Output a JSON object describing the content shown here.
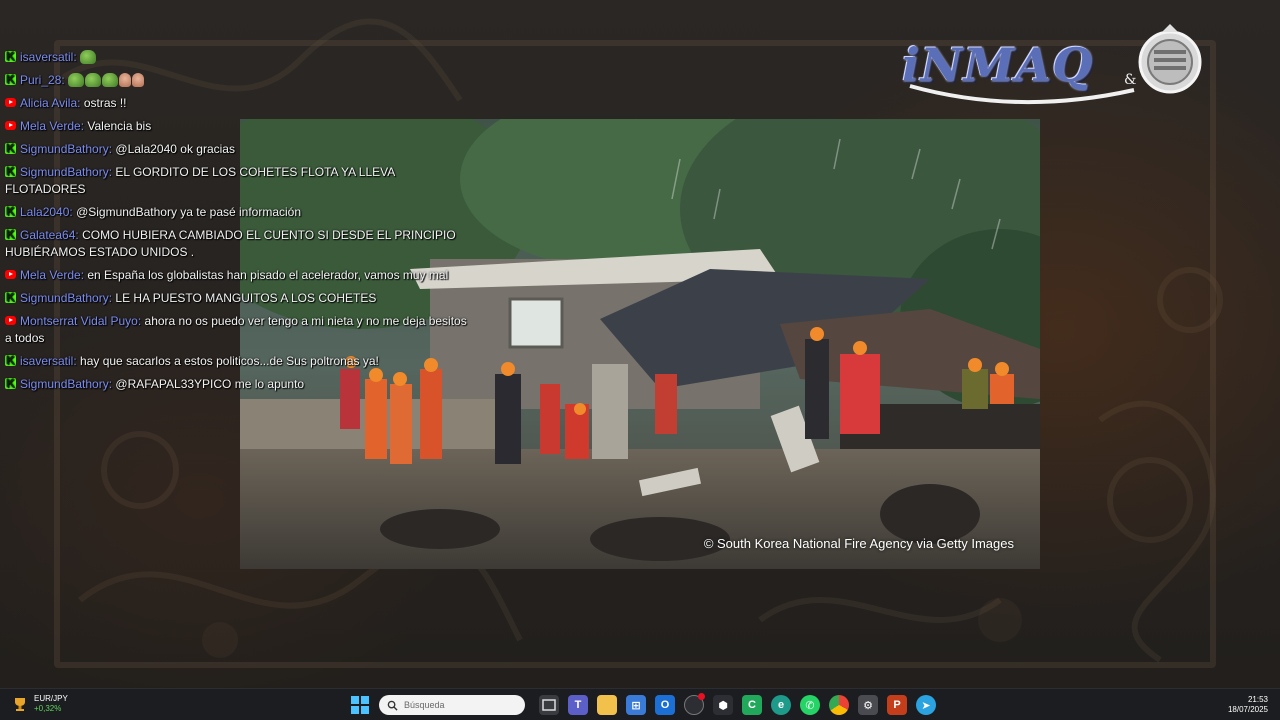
{
  "chat": {
    "messages": [
      {
        "platform": "kick",
        "user": "isaversatil",
        "text": "",
        "emotes": [
          "frog"
        ]
      },
      {
        "platform": "kick",
        "user": "Puri_28",
        "text": "",
        "emotes": [
          "frog",
          "frog",
          "frog",
          "hand",
          "hand"
        ]
      },
      {
        "platform": "youtube",
        "user": "Alicia Avila",
        "text": "ostras !!",
        "emotes": []
      },
      {
        "platform": "youtube",
        "user": "Mela Verde",
        "text": "Valencia bis",
        "emotes": []
      },
      {
        "platform": "kick",
        "user": "SigmundBathory",
        "text": "@Lala2040 ok gracias",
        "emotes": []
      },
      {
        "platform": "kick",
        "user": "SigmundBathory",
        "text": "EL GORDITO DE LOS COHETES FLOTA YA LLEVA FLOTADORES",
        "emotes": []
      },
      {
        "platform": "kick",
        "user": "Lala2040",
        "text": "@SigmundBathory ya te pasé información",
        "emotes": []
      },
      {
        "platform": "kick",
        "user": "Galatea64",
        "text": "COMO HUBIERA CAMBIADO EL CUENTO SI DESDE EL PRINCIPIO HUBIÉRAMOS ESTADO UNIDOS .",
        "emotes": []
      },
      {
        "platform": "youtube",
        "user": "Mela Verde",
        "text": "en España los globalistas han pisado el acelerador, vamos muy mal",
        "emotes": []
      },
      {
        "platform": "kick",
        "user": "SigmundBathory",
        "text": "LE HA PUESTO MANGUITOS A LOS COHETES",
        "emotes": []
      },
      {
        "platform": "youtube",
        "user": "Montserrat Vidal Puyo",
        "text": "ahora no os puedo ver tengo a mi nieta y no me deja besitos a todos",
        "emotes": []
      },
      {
        "platform": "kick",
        "user": "isaversatil",
        "text": "hay que sacarlos a estos politicos...de Sus poltronas ya!",
        "emotes": []
      },
      {
        "platform": "kick",
        "user": "SigmundBathory",
        "text": "@RAFAPAL33YPICO me lo apunto",
        "emotes": []
      }
    ]
  },
  "logo": {
    "text": "iNMAQ",
    "amp": "&"
  },
  "photo": {
    "credit": "© South Korea National Fire Agency via Getty Images"
  },
  "taskbar": {
    "ticker": {
      "pair": "EUR/JPY",
      "change": "+0,32%"
    },
    "search_placeholder": "Búsqueda",
    "apps": [
      "windows-start",
      "search",
      "task-view",
      "teams",
      "file-explorer",
      "store",
      "outlook",
      "copilot",
      "github",
      "camtasia",
      "edge",
      "whatsapp",
      "chrome",
      "settings",
      "powerpoint",
      "telegram"
    ],
    "clock": {
      "time": "21:53",
      "date": "18/07/2025"
    }
  },
  "colors": {
    "username": "#7b8cf0",
    "kick": "#53fc18",
    "youtube": "#ff0000",
    "taskbar": "#1c1d20"
  }
}
